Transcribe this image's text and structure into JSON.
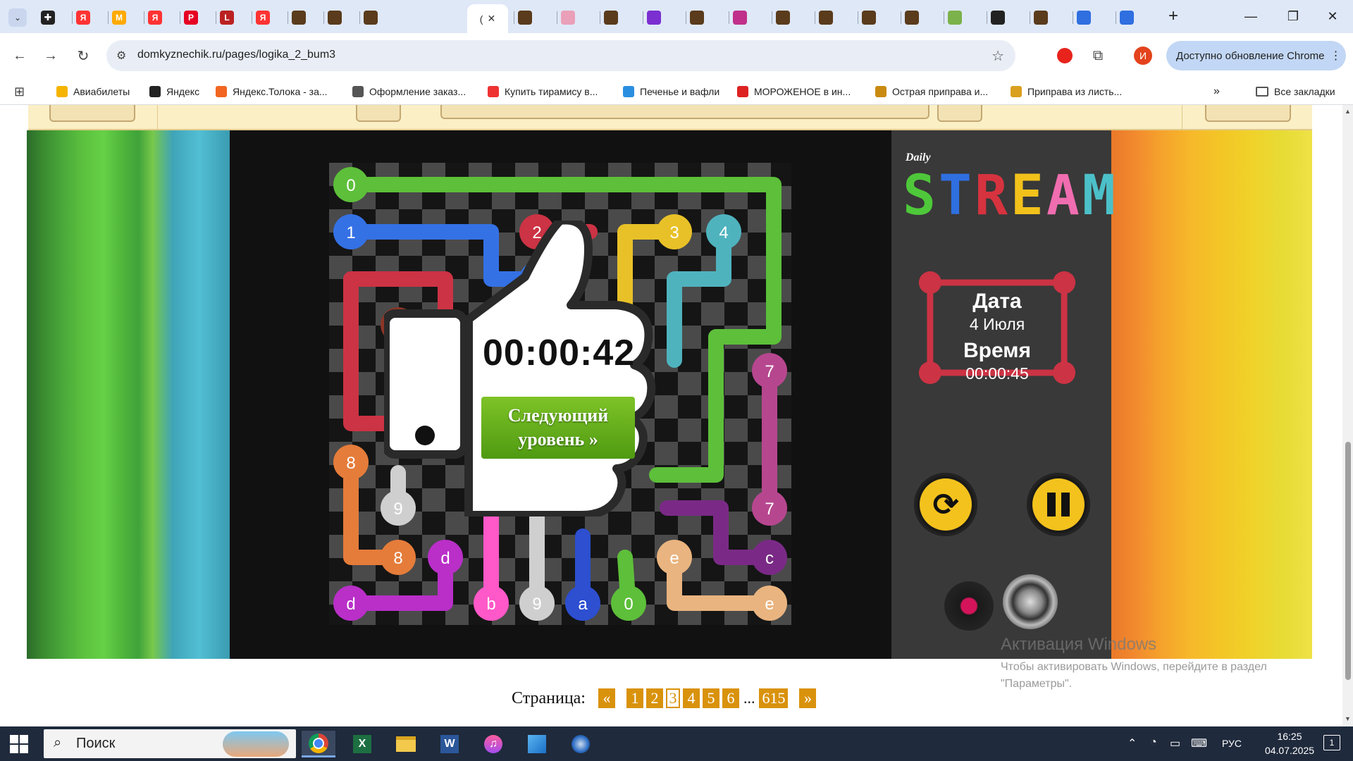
{
  "browser": {
    "tabs": [
      {
        "letter": "Я",
        "color": "#f33"
      },
      {
        "letter": "M",
        "color": "#fa0"
      },
      {
        "letter": "Я",
        "color": "#f33"
      },
      {
        "letter": "P",
        "color": "#e60023"
      },
      {
        "letter": "L",
        "color": "#b22"
      },
      {
        "letter": "Я",
        "color": "#f33"
      },
      {
        "letter": "",
        "color": "#5a3b1c"
      },
      {
        "letter": "",
        "color": "#5a3b1c"
      },
      {
        "letter": "",
        "color": "#5a3b1c"
      }
    ],
    "active_tab_letter": "(",
    "url": "domkyznechik.ru/pages/logika_2_bum3",
    "update_label": "Доступно обновление Chrome",
    "profile_initial": "И",
    "bookmarks": [
      {
        "label": "Авиабилеты",
        "color": "#f5b400"
      },
      {
        "label": "Яндекс",
        "color": "#222"
      },
      {
        "label": "Яндекс.Толока - за...",
        "color": "#f26522"
      },
      {
        "label": "Оформление заказ...",
        "color": "#555"
      },
      {
        "label": "Купить тирамису в...",
        "color": "#e33"
      },
      {
        "label": "Печенье и вафли",
        "color": "#2a8ee0"
      },
      {
        "label": "МОРОЖЕНОЕ в ин...",
        "color": "#d22"
      },
      {
        "label": "Острая приправа и...",
        "color": "#c98a10"
      },
      {
        "label": "Приправа из листь...",
        "color": "#d9a020"
      }
    ],
    "all_bookmarks": "Все закладки"
  },
  "game": {
    "logo_daily": "Daily",
    "logo_letters": [
      {
        "ch": "S",
        "color": "#4ec83a"
      },
      {
        "ch": "T",
        "color": "#2f6fe0"
      },
      {
        "ch": "R",
        "color": "#d6333f"
      },
      {
        "ch": "E",
        "color": "#f2c21b"
      },
      {
        "ch": "A",
        "color": "#f06db0"
      },
      {
        "ch": "M",
        "color": "#4cc0c8"
      }
    ],
    "date_label": "Дата",
    "date_value": "4 Июля",
    "time_label": "Время",
    "time_value": "00:00:45",
    "result_time": "00:00:42",
    "next_level_line1": "Следующий",
    "next_level_line2": "уровень »"
  },
  "watermark": {
    "title": "Активация Windows",
    "line1": "Чтобы активировать Windows, перейдите в раздел",
    "line2": "\"Параметры\"."
  },
  "pagination": {
    "label": "Страница:",
    "prev": "«",
    "pages": [
      "1",
      "2",
      "3",
      "4",
      "5",
      "6"
    ],
    "current": "3",
    "dots": "...",
    "last": "615",
    "next": "»"
  },
  "taskbar": {
    "search_placeholder": "Поиск",
    "lang": "РУС",
    "time": "16:25",
    "date": "04.07.2025",
    "notifications": "1"
  }
}
